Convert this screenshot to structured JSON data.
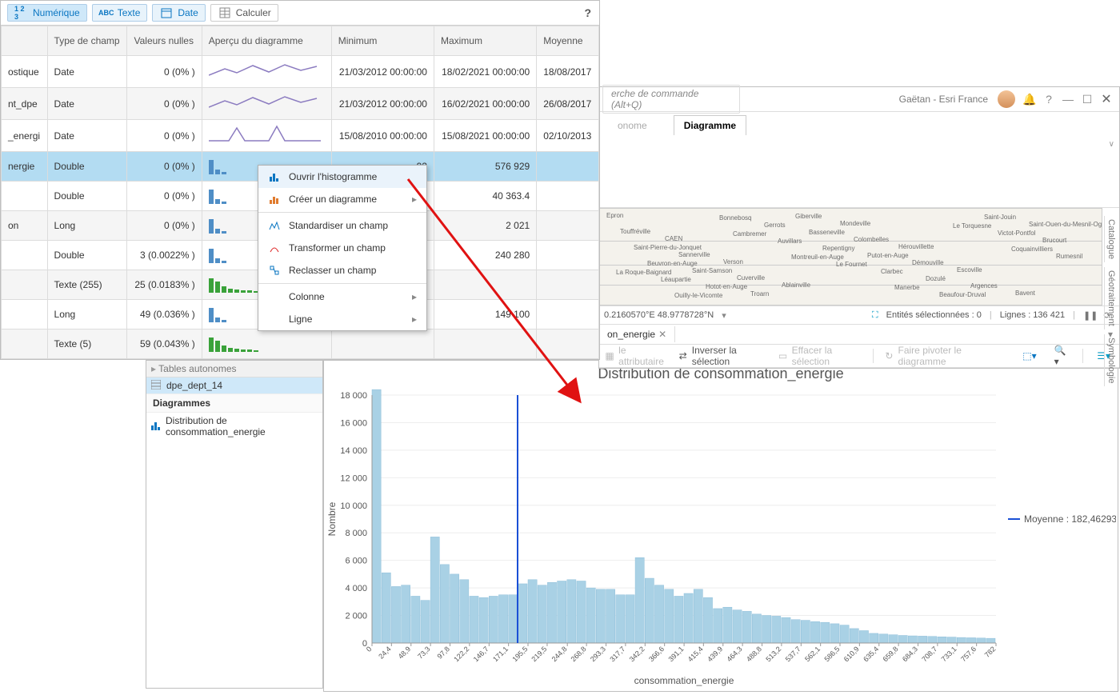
{
  "toolbar": {
    "numeric": "Numérique",
    "text": "Texte",
    "date": "Date",
    "calc": "Calculer",
    "help": "?"
  },
  "columns": {
    "c0": "",
    "c1": "Type de champ",
    "c2": "Valeurs nulles",
    "c3": "Aperçu du diagramme",
    "c4": "Minimum",
    "c5": "Maximum",
    "c6": "Moyenne"
  },
  "rows": [
    {
      "name": "ostique",
      "type": "Date",
      "nulls": "0 (0% )",
      "spark": "line",
      "min": "21/03/2012 00:00:00",
      "max": "18/02/2021 00:00:00",
      "mean": "18/08/2017"
    },
    {
      "name": "nt_dpe",
      "type": "Date",
      "nulls": "0 (0% )",
      "spark": "line",
      "min": "21/03/2012 00:00:00",
      "max": "16/02/2021 00:00:00",
      "mean": "26/08/2017"
    },
    {
      "name": "_energi",
      "type": "Date",
      "nulls": "0 (0% )",
      "spark": "peaks",
      "min": "15/08/2010 00:00:00",
      "max": "15/08/2021 00:00:00",
      "mean": "02/10/2013"
    },
    {
      "name": "nergie",
      "type": "Double",
      "nulls": "0 (0% )",
      "spark": "bar",
      "min": "-92",
      "max": "576 929",
      "mean": "",
      "selected": true
    },
    {
      "name": "",
      "type": "Double",
      "nulls": "0 (0% )",
      "spark": "bar",
      "min": "",
      "max": "40 363.4",
      "mean": ""
    },
    {
      "name": "on",
      "type": "Long",
      "nulls": "0 (0% )",
      "spark": "bar",
      "min": "",
      "max": "2 021",
      "mean": ""
    },
    {
      "name": "",
      "type": "Double",
      "nulls": "3 (0.0022% )",
      "spark": "bar",
      "min": "",
      "max": "240 280",
      "mean": ""
    },
    {
      "name": "",
      "type": "Texte (255)",
      "nulls": "25 (0.0183% )",
      "spark": "gbar",
      "min": "",
      "max": "",
      "mean": ""
    },
    {
      "name": "",
      "type": "Long",
      "nulls": "49 (0.036% )",
      "spark": "bar",
      "min": "",
      "max": "149 100",
      "mean": ""
    },
    {
      "name": "",
      "type": "Texte (5)",
      "nulls": "59 (0.043% )",
      "spark": "gbar",
      "min": "",
      "max": "",
      "mean": ""
    }
  ],
  "context_menu": {
    "open_hist": "Ouvrir l'histogramme",
    "create_chart": "Créer un diagramme",
    "standardize": "Standardiser un champ",
    "transform": "Transformer un champ",
    "reclass": "Reclasser un champ",
    "column": "Colonne",
    "row": "Ligne"
  },
  "window": {
    "search_placeholder": "erche de commande (Alt+Q)",
    "user": "Gaëtan - Esri France",
    "tabs": {
      "autonome": "onome",
      "diagramme": "Diagramme"
    },
    "side_tabs": {
      "catalog": "Catalogue",
      "geoproc": "Géotraitement",
      "symbology": "Symbologie"
    },
    "coords": "0.2160570°E 48.9778728°N",
    "selection_label": "Entités sélectionnées : 0",
    "rows_label": "Lignes : 136 421",
    "doc_tab": "on_energie",
    "tools": {
      "table_attr": "le attributaire",
      "inverse": "Inverser la sélection",
      "clear": "Effacer la sélection",
      "pivot": "Faire pivoter le diagramme"
    },
    "map_labels": [
      "Epron",
      "CAEN",
      "Verson",
      "Ablainville",
      "Mondeville",
      "Hérouvillette",
      "Escoville",
      "Bavent",
      "Touffréville",
      "Sannerville",
      "Cuverville",
      "Giberville",
      "Colombelles",
      "Démouville",
      "Argences",
      "Saint-Ouen-du-Mesnil-Oger",
      "Saint-Pierre-du-Jonquet",
      "Saint-Samson",
      "Troarn",
      "Basseneville",
      "Putot-en-Auge",
      "Dozulé",
      "Saint-Jouin",
      "Brucourt",
      "Beuvron-en-Auge",
      "Hotot-en-Auge",
      "Gerrots",
      "Repentigny",
      "Clarbec",
      "Beaufour-Druval",
      "Victot-Pontfol",
      "Rumesnil",
      "Léaupartie",
      "Bonnebosq",
      "Auvillars",
      "Le Fournet",
      "Manerbe",
      "Le Torquesne",
      "Coquainvilliers",
      "La Roque-Baignard",
      "Ouilly-le-Vicomte",
      "Cambremer",
      "Montreuil-en-Auge"
    ]
  },
  "tree": {
    "header": "Tables autonomes",
    "layer": "dpe_dept_14",
    "section": "Diagrammes",
    "chart_item": "Distribution de consommation_energie"
  },
  "chart_data": {
    "type": "bar",
    "title": "Distribution de consommation_energie",
    "xlabel": "consommation_energie",
    "ylabel": "Nombre",
    "ylim": [
      0,
      18000
    ],
    "yticks": [
      0,
      2000,
      4000,
      6000,
      8000,
      10000,
      12000,
      14000,
      16000,
      18000
    ],
    "ytick_labels": [
      "0",
      "2 000",
      "4 000",
      "6 000",
      "8 000",
      "10 000",
      "12 000",
      "14 000",
      "16 000",
      "18 000"
    ],
    "xticks": [
      0,
      24.4,
      48.9,
      73.3,
      97.8,
      122.2,
      146.7,
      171.1,
      195.5,
      219.5,
      244.8,
      268.8,
      293.3,
      317.7,
      342.2,
      366.6,
      391.1,
      415.4,
      439.9,
      464.3,
      488.8,
      513.2,
      537.7,
      562.1,
      586.5,
      610.9,
      635.4,
      659.8,
      684.3,
      708.7,
      733.1,
      757.6,
      782
    ],
    "xtick_labels": [
      "0",
      "24,4",
      "48,9",
      "73,3",
      "97,8",
      "122,2",
      "146,7",
      "171,1",
      "195,5",
      "219,5",
      "244,8",
      "268,8",
      "293,3",
      "317,7",
      "342,2",
      "366,6",
      "391,1",
      "415,4",
      "439,9",
      "464,3",
      "488,8",
      "513,2",
      "537,7",
      "562,1",
      "586,5",
      "610,9",
      "635,4",
      "659,8",
      "684,3",
      "708,7",
      "733,1",
      "757,6",
      "782"
    ],
    "mean": 182.46293,
    "legend_mean": "Moyenne : 182,46293",
    "values": [
      18400,
      5100,
      4100,
      4200,
      3400,
      3100,
      7700,
      5700,
      5000,
      4600,
      3400,
      3300,
      3400,
      3500,
      3500,
      4300,
      4600,
      4200,
      4400,
      4500,
      4600,
      4500,
      4000,
      3900,
      3900,
      3500,
      3500,
      6200,
      4700,
      4200,
      3900,
      3400,
      3600,
      3900,
      3300,
      2500,
      2600,
      2400,
      2300,
      2100,
      2000,
      1950,
      1850,
      1700,
      1650,
      1550,
      1500,
      1400,
      1300,
      1050,
      900,
      700,
      650,
      600,
      550,
      520,
      500,
      480,
      450,
      430,
      400,
      380,
      360,
      340
    ]
  }
}
